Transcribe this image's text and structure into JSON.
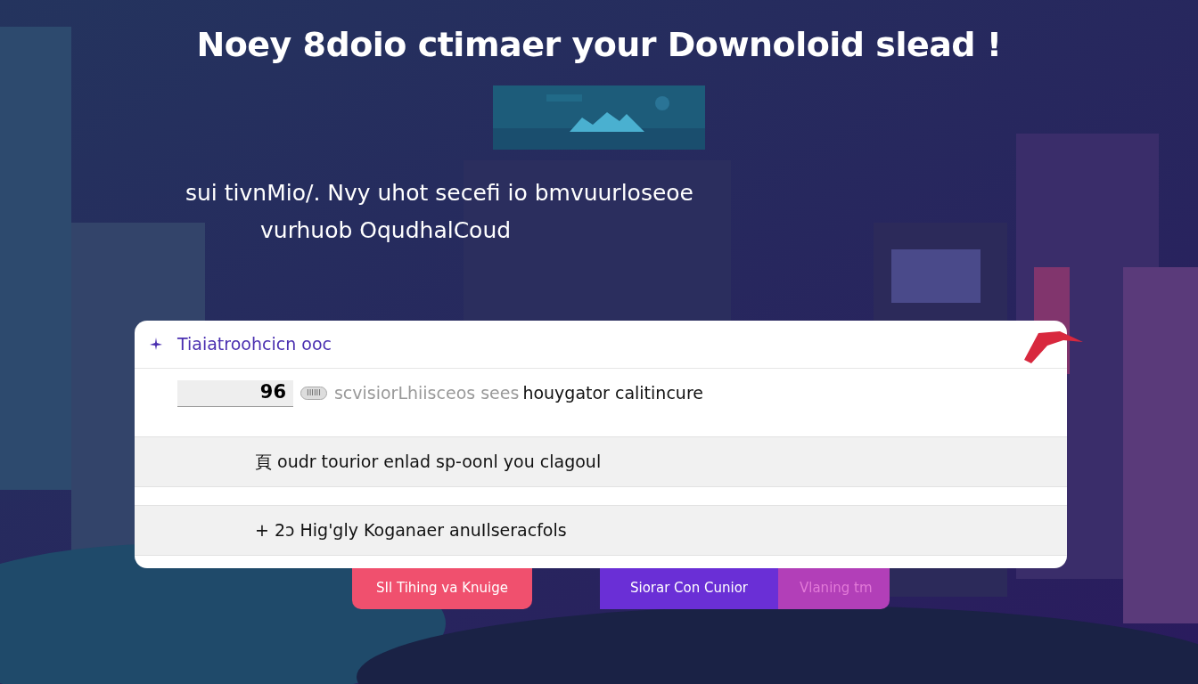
{
  "title": "Noey 8doio ctimaer your Downoloid slead !",
  "hero": {
    "kind": "picture"
  },
  "subtitle": [
    "sui tivnMio/. Nvy uhot secefi io bmvuurloseoe",
    "vurhuob OqudhalCoud"
  ],
  "card": {
    "header": "Tiaiatroohcicn ooc",
    "rows": [
      {
        "kind": "field",
        "field_value": "96",
        "tag": "IIIIII",
        "hint": "scvisiorLhiisceos sees",
        "text": "houygator calitincure"
      },
      {
        "kind": "item",
        "prefix": "頁",
        "text": "oudr tourior enlad sp-oonl you clagoul"
      },
      {
        "kind": "item",
        "prefix": "+ 2ɔ",
        "text": "Hig'gly Koganaer anuIlseracfols"
      }
    ]
  },
  "buttons": [
    {
      "label": "SIl Tihing va Knuige",
      "color": "#f0506e"
    },
    {
      "label": "Siorar Con Cunior",
      "color": "#6a2fd6"
    },
    {
      "label": "Vlaning tm",
      "color": "#b23fb8"
    }
  ]
}
